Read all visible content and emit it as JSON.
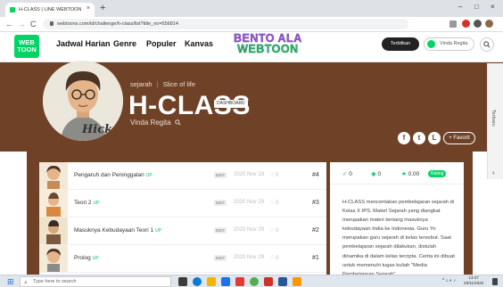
{
  "browser": {
    "tab_title": "H-CLASS | LINE WEBTOON",
    "tab_close": "×",
    "new_tab": "+",
    "url": "webtoons.com/id/challenge/h-class/list?title_no=556814",
    "controls": {
      "minimize": "–",
      "maximize": "□",
      "close": "×"
    },
    "nav": {
      "back": "←",
      "forward": "→",
      "reload": "C"
    }
  },
  "site": {
    "logo_line1": "WEB",
    "logo_line2": "TOON",
    "menu": [
      "Jadwal Harian",
      "Genre",
      "Populer",
      "Kanvas"
    ],
    "banner_line1": "BENTO ALA",
    "banner_line2": "WEBTOON",
    "publish_label": "Terbitkan",
    "user_label": "Vinda Regita",
    "search_icon": "search-icon"
  },
  "series": {
    "genre": "sejarah",
    "separator": "|",
    "subgenre": "Slice of life",
    "title": "H-CLASS",
    "dashboard_label": "DASHBOARD",
    "author": "Vinda Regita",
    "favorite_label": "+ Favorit",
    "side_tab": "Terbaru",
    "avatar_caption": "Hick"
  },
  "episodes": [
    {
      "title": "Pengaruh dan Peninggalan",
      "up": "UP",
      "edit": "EDIT",
      "date": "2020 Nov 29",
      "likes": "0",
      "num": "#4"
    },
    {
      "title": "Teori 2",
      "up": "UP",
      "edit": "EDIT",
      "date": "2020 Nov 29",
      "likes": "0",
      "num": "#3"
    },
    {
      "title": "Masuknya Kebudayaan Teori 1",
      "up": "UP",
      "edit": "EDIT",
      "date": "2020 Nov 29",
      "likes": "0",
      "num": "#2"
    },
    {
      "title": "Prolog",
      "up": "UP",
      "edit": "EDIT",
      "date": "2020 Nov 29",
      "likes": "0",
      "num": "#1"
    }
  ],
  "stats": {
    "subscribers": "0",
    "views": "0",
    "rating": "0.00",
    "rating_label": "Rating"
  },
  "description": "H-CLASS mencentakan pembelajaran sejarah di Kelas X IPS. Materi Sejarah yang diangkat merupakan materi tentang masuknya kebudayaan India ke Indonesia. Guru Yo merupakan guru sejarah di kelas tersebut. Saat pembelajaran sejarah dilakukan, distulah dinamika di dalam kelas tercipta. Cerita ini dibuat untuk memenuhi tugas kuliah \"Media Pembelajaran Sejarah\".",
  "taskbar": {
    "search_placeholder": "Type here to search",
    "time": "13:47",
    "date": "29/11/2020"
  },
  "colors": {
    "brand_green": "#00d564",
    "hero_brown": "#6f4227"
  }
}
